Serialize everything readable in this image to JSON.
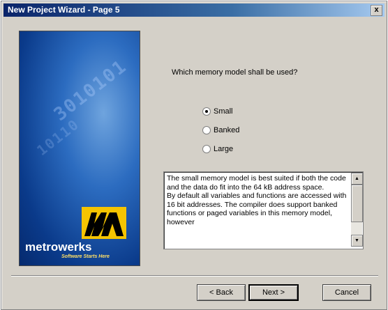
{
  "window": {
    "title": "New Project Wizard - Page  5",
    "close_symbol": "x"
  },
  "banner": {
    "brand": "metrowerks",
    "tagline": "Software Starts Here",
    "logo_colors": {
      "logo_bg": "#f5c400",
      "logo_fg": "#000000"
    },
    "decor_digits": "3010101",
    "decor_digits2": "10110"
  },
  "main": {
    "question": "Which memory model shall be used?",
    "options": [
      {
        "label": "Small",
        "checked": true
      },
      {
        "label": "Banked",
        "checked": false
      },
      {
        "label": "Large",
        "checked": false
      }
    ],
    "description": "The small memory model is best suited if both the code and the data do fit into the 64 kB address space.\nBy default all variables and functions are accessed with 16 bit addresses. The compiler does support banked functions or paged variables in this memory model, however"
  },
  "scrollbar": {
    "up_icon": "▲",
    "down_icon": "▼"
  },
  "buttons": {
    "back": "< Back",
    "next": "Next >",
    "cancel": "Cancel"
  },
  "colors": {
    "titlebar_start": "#0a246a",
    "titlebar_end": "#a6caf0",
    "dialog_bg": "#d4d0c8"
  }
}
